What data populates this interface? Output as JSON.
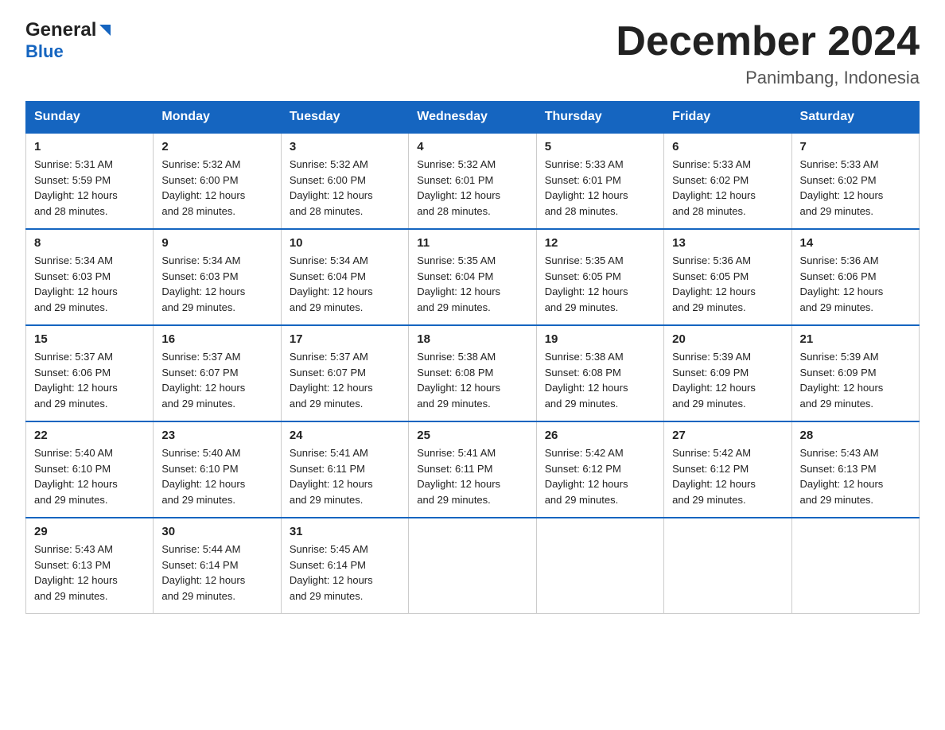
{
  "header": {
    "logo_general": "General",
    "logo_blue": "Blue",
    "month_title": "December 2024",
    "location": "Panimbang, Indonesia"
  },
  "days_of_week": [
    "Sunday",
    "Monday",
    "Tuesday",
    "Wednesday",
    "Thursday",
    "Friday",
    "Saturday"
  ],
  "weeks": [
    [
      {
        "day": "1",
        "sunrise": "5:31 AM",
        "sunset": "5:59 PM",
        "daylight": "12 hours and 28 minutes."
      },
      {
        "day": "2",
        "sunrise": "5:32 AM",
        "sunset": "6:00 PM",
        "daylight": "12 hours and 28 minutes."
      },
      {
        "day": "3",
        "sunrise": "5:32 AM",
        "sunset": "6:00 PM",
        "daylight": "12 hours and 28 minutes."
      },
      {
        "day": "4",
        "sunrise": "5:32 AM",
        "sunset": "6:01 PM",
        "daylight": "12 hours and 28 minutes."
      },
      {
        "day": "5",
        "sunrise": "5:33 AM",
        "sunset": "6:01 PM",
        "daylight": "12 hours and 28 minutes."
      },
      {
        "day": "6",
        "sunrise": "5:33 AM",
        "sunset": "6:02 PM",
        "daylight": "12 hours and 28 minutes."
      },
      {
        "day": "7",
        "sunrise": "5:33 AM",
        "sunset": "6:02 PM",
        "daylight": "12 hours and 29 minutes."
      }
    ],
    [
      {
        "day": "8",
        "sunrise": "5:34 AM",
        "sunset": "6:03 PM",
        "daylight": "12 hours and 29 minutes."
      },
      {
        "day": "9",
        "sunrise": "5:34 AM",
        "sunset": "6:03 PM",
        "daylight": "12 hours and 29 minutes."
      },
      {
        "day": "10",
        "sunrise": "5:34 AM",
        "sunset": "6:04 PM",
        "daylight": "12 hours and 29 minutes."
      },
      {
        "day": "11",
        "sunrise": "5:35 AM",
        "sunset": "6:04 PM",
        "daylight": "12 hours and 29 minutes."
      },
      {
        "day": "12",
        "sunrise": "5:35 AM",
        "sunset": "6:05 PM",
        "daylight": "12 hours and 29 minutes."
      },
      {
        "day": "13",
        "sunrise": "5:36 AM",
        "sunset": "6:05 PM",
        "daylight": "12 hours and 29 minutes."
      },
      {
        "day": "14",
        "sunrise": "5:36 AM",
        "sunset": "6:06 PM",
        "daylight": "12 hours and 29 minutes."
      }
    ],
    [
      {
        "day": "15",
        "sunrise": "5:37 AM",
        "sunset": "6:06 PM",
        "daylight": "12 hours and 29 minutes."
      },
      {
        "day": "16",
        "sunrise": "5:37 AM",
        "sunset": "6:07 PM",
        "daylight": "12 hours and 29 minutes."
      },
      {
        "day": "17",
        "sunrise": "5:37 AM",
        "sunset": "6:07 PM",
        "daylight": "12 hours and 29 minutes."
      },
      {
        "day": "18",
        "sunrise": "5:38 AM",
        "sunset": "6:08 PM",
        "daylight": "12 hours and 29 minutes."
      },
      {
        "day": "19",
        "sunrise": "5:38 AM",
        "sunset": "6:08 PM",
        "daylight": "12 hours and 29 minutes."
      },
      {
        "day": "20",
        "sunrise": "5:39 AM",
        "sunset": "6:09 PM",
        "daylight": "12 hours and 29 minutes."
      },
      {
        "day": "21",
        "sunrise": "5:39 AM",
        "sunset": "6:09 PM",
        "daylight": "12 hours and 29 minutes."
      }
    ],
    [
      {
        "day": "22",
        "sunrise": "5:40 AM",
        "sunset": "6:10 PM",
        "daylight": "12 hours and 29 minutes."
      },
      {
        "day": "23",
        "sunrise": "5:40 AM",
        "sunset": "6:10 PM",
        "daylight": "12 hours and 29 minutes."
      },
      {
        "day": "24",
        "sunrise": "5:41 AM",
        "sunset": "6:11 PM",
        "daylight": "12 hours and 29 minutes."
      },
      {
        "day": "25",
        "sunrise": "5:41 AM",
        "sunset": "6:11 PM",
        "daylight": "12 hours and 29 minutes."
      },
      {
        "day": "26",
        "sunrise": "5:42 AM",
        "sunset": "6:12 PM",
        "daylight": "12 hours and 29 minutes."
      },
      {
        "day": "27",
        "sunrise": "5:42 AM",
        "sunset": "6:12 PM",
        "daylight": "12 hours and 29 minutes."
      },
      {
        "day": "28",
        "sunrise": "5:43 AM",
        "sunset": "6:13 PM",
        "daylight": "12 hours and 29 minutes."
      }
    ],
    [
      {
        "day": "29",
        "sunrise": "5:43 AM",
        "sunset": "6:13 PM",
        "daylight": "12 hours and 29 minutes."
      },
      {
        "day": "30",
        "sunrise": "5:44 AM",
        "sunset": "6:14 PM",
        "daylight": "12 hours and 29 minutes."
      },
      {
        "day": "31",
        "sunrise": "5:45 AM",
        "sunset": "6:14 PM",
        "daylight": "12 hours and 29 minutes."
      },
      null,
      null,
      null,
      null
    ]
  ],
  "labels": {
    "sunrise": "Sunrise:",
    "sunset": "Sunset:",
    "daylight": "Daylight:"
  }
}
